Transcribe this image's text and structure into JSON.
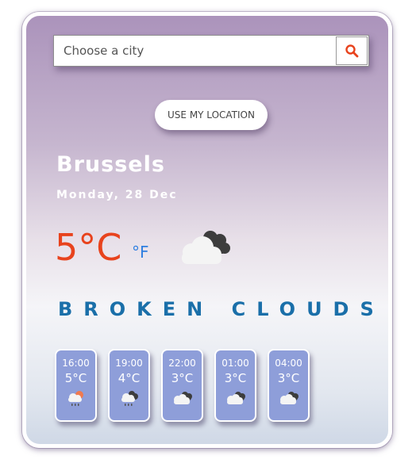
{
  "search": {
    "placeholder": "Choose a city",
    "button_icon": "search-icon"
  },
  "location_button": {
    "label": "USE MY LOCATION"
  },
  "weather": {
    "city": "Brussels",
    "date": "Monday, 28 Dec",
    "temperature": "5°C",
    "alt_unit": "°F",
    "description": "BROKEN CLOUDS",
    "icon": "broken-clouds-icon"
  },
  "forecast": [
    {
      "time": "16:00",
      "temp": "5°C",
      "icon": "rain-sun-cloud-icon"
    },
    {
      "time": "19:00",
      "temp": "4°C",
      "icon": "rain-dark-cloud-icon"
    },
    {
      "time": "22:00",
      "temp": "3°C",
      "icon": "broken-clouds-icon"
    },
    {
      "time": "01:00",
      "temp": "3°C",
      "icon": "broken-clouds-icon"
    },
    {
      "time": "04:00",
      "temp": "3°C",
      "icon": "broken-clouds-icon"
    }
  ],
  "colors": {
    "temperature": "#e8431d",
    "unit_toggle": "#2f7fe0",
    "description": "#1a6fa9",
    "forecast_card": "#8e9ed9",
    "search_icon": "#e8431d"
  }
}
